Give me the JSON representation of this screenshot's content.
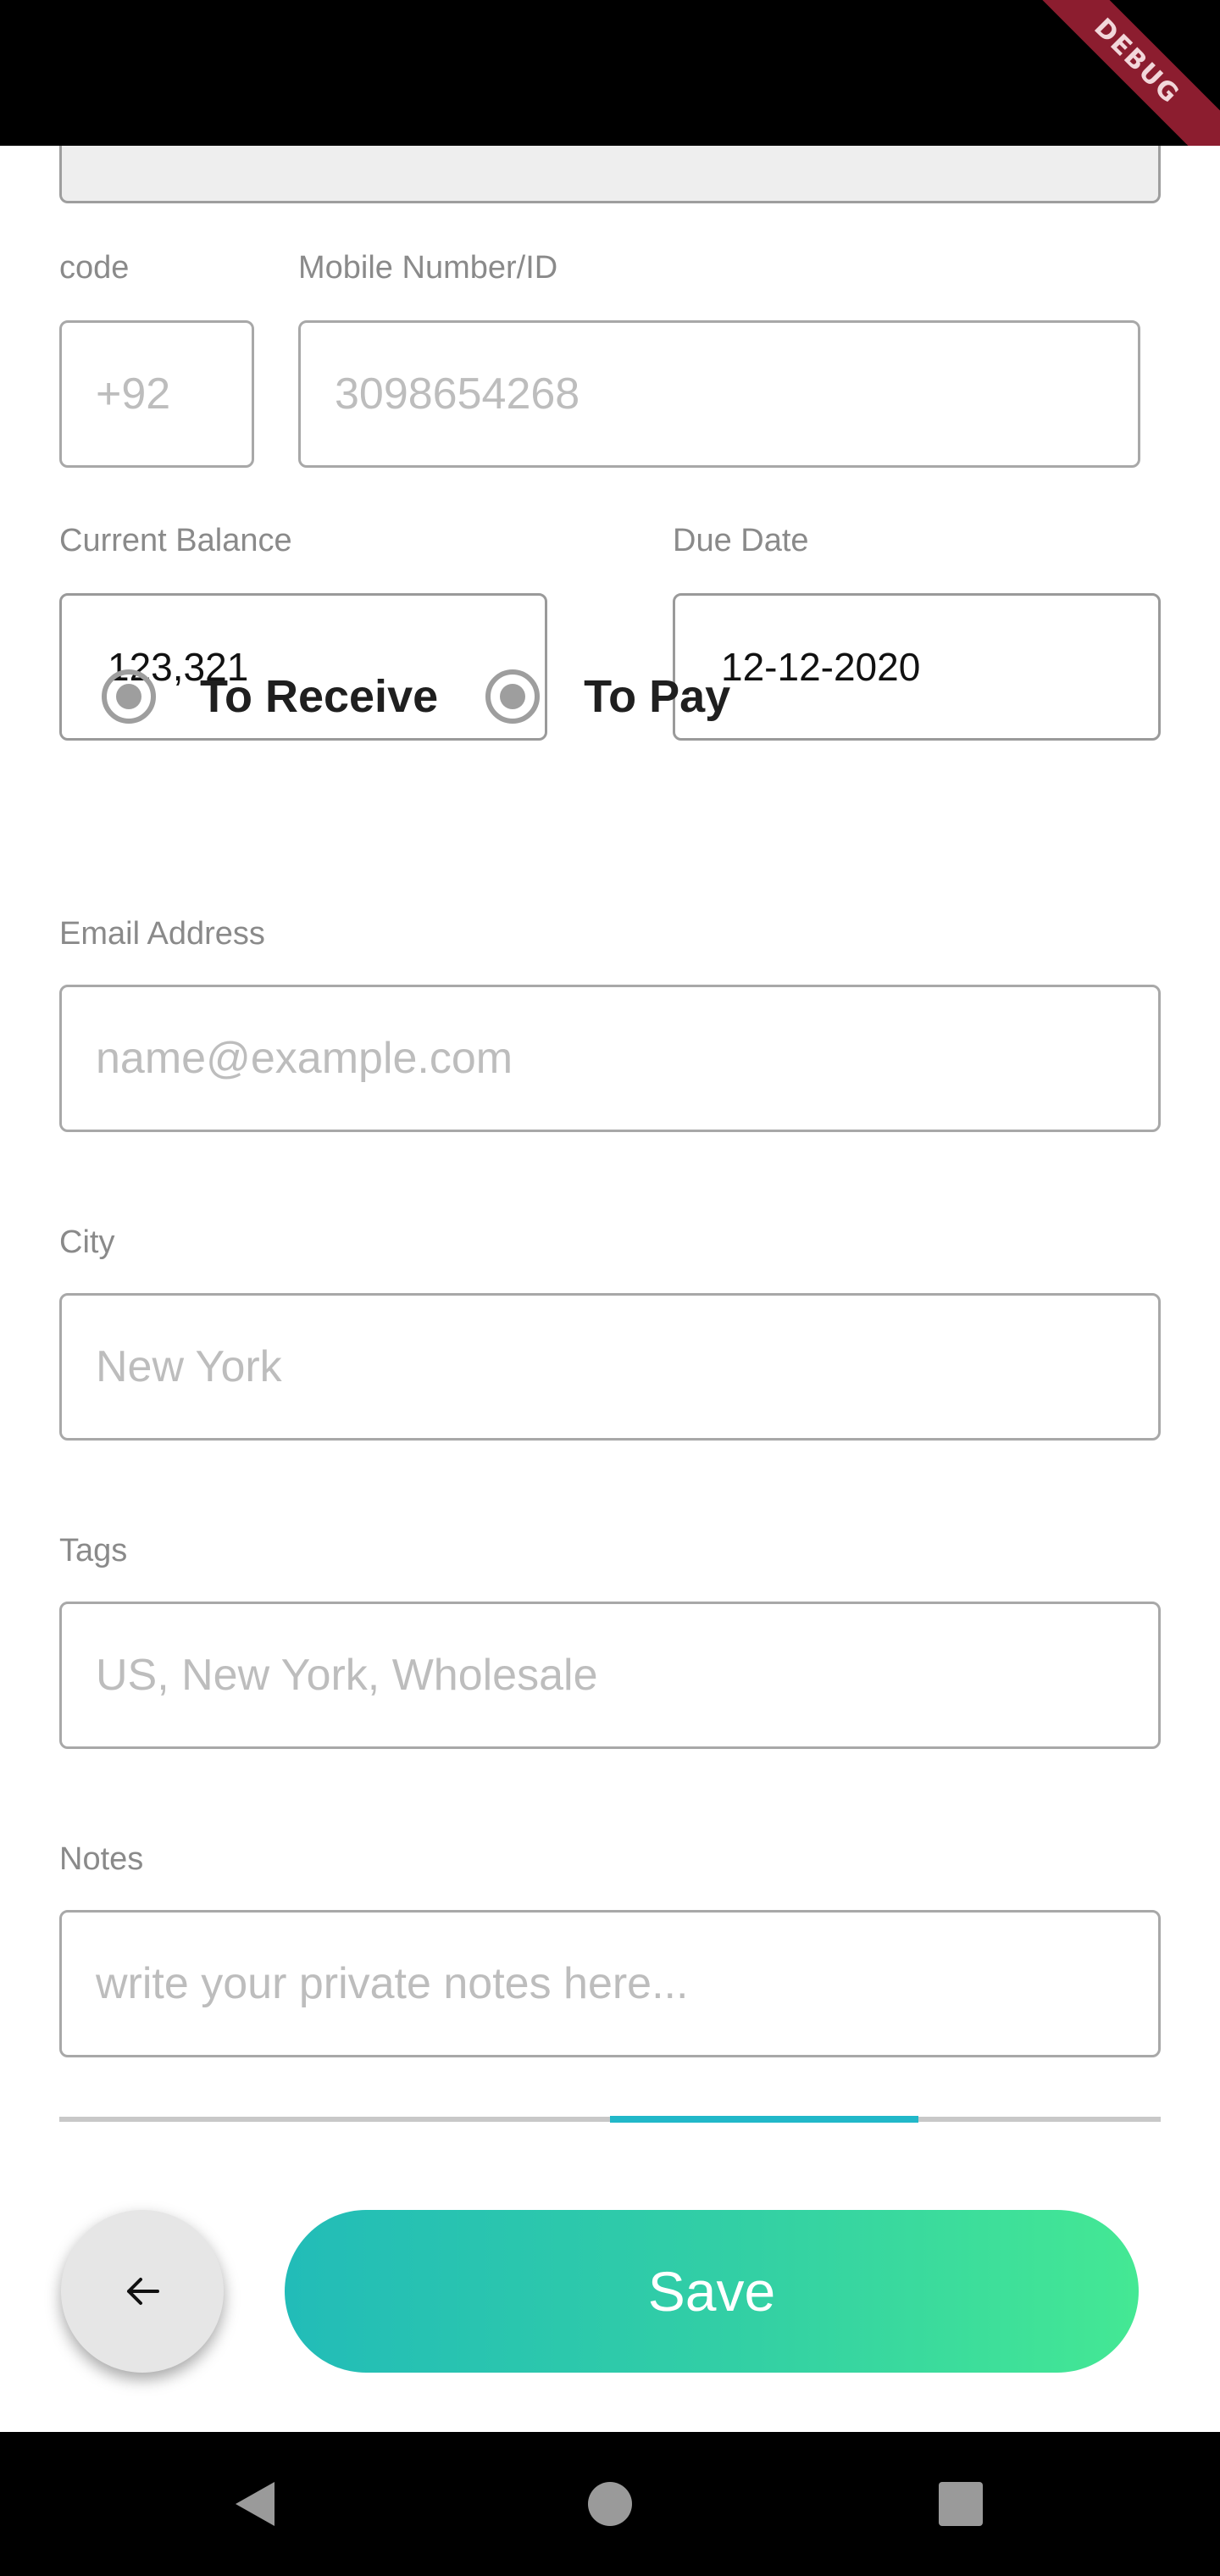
{
  "status_bar": {
    "debug_banner": "DEBUG"
  },
  "form": {
    "code": {
      "label": "code",
      "placeholder": "+92"
    },
    "mobile": {
      "label": "Mobile Number/ID",
      "placeholder": "3098654268"
    },
    "balance": {
      "label": "Current Balance",
      "value": "123,321"
    },
    "due_date": {
      "label": "Due Date",
      "value": "12-12-2020"
    },
    "radio": {
      "options": [
        {
          "label": "To Receive",
          "selected": true
        },
        {
          "label": "To Pay",
          "selected": true
        }
      ]
    },
    "email": {
      "label": "Email Address",
      "placeholder": "name@example.com"
    },
    "city": {
      "label": "City",
      "placeholder": "New York"
    },
    "tags": {
      "label": "Tags",
      "placeholder": "US, New York, Wholesale"
    },
    "notes": {
      "label": "Notes",
      "placeholder": "write your private notes here..."
    }
  },
  "progress": {
    "segment_start": 0.5,
    "segment_end": 0.78
  },
  "actions": {
    "back_icon": "arrow-left-icon",
    "save_label": "Save"
  },
  "nav": {
    "icons": [
      "back-triangle-icon",
      "home-circle-icon",
      "recents-square-icon"
    ]
  },
  "colors": {
    "accent_start": "#22bcb8",
    "accent_end": "#44e894",
    "progress": "#22b8c9",
    "debug": "#8c1d2f"
  }
}
